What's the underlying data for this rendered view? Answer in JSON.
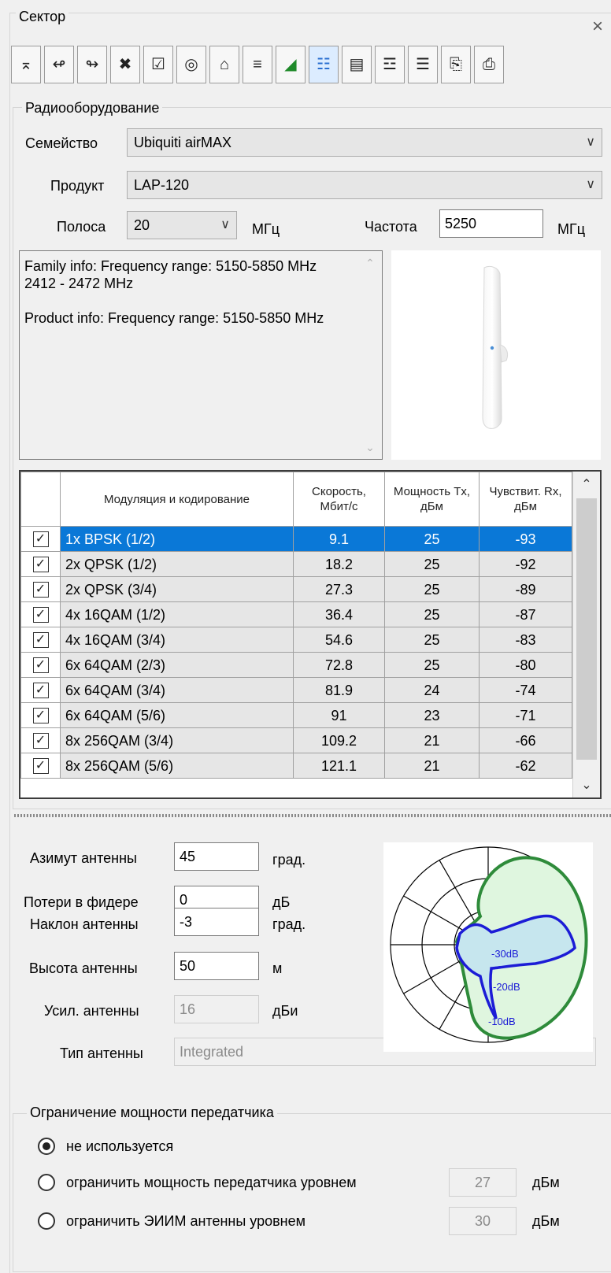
{
  "panel": {
    "title": "Сектор",
    "close_icon": "close-icon"
  },
  "toolbar": {
    "buttons": [
      {
        "icon": "add-sector-icon",
        "glyph": "⌅"
      },
      {
        "icon": "rotate-left-icon",
        "glyph": "↫"
      },
      {
        "icon": "rotate-right-icon",
        "glyph": "↬"
      },
      {
        "icon": "delete-icon",
        "glyph": "✖"
      },
      {
        "icon": "checkbox-icon",
        "glyph": "☑"
      },
      {
        "icon": "target-icon",
        "glyph": "◎"
      },
      {
        "icon": "add-link-icon",
        "glyph": "⌂"
      },
      {
        "icon": "sort-icon",
        "glyph": "≡"
      },
      {
        "icon": "terrain-chart-icon",
        "glyph": "◢"
      },
      {
        "icon": "document-icon",
        "glyph": "☷"
      },
      {
        "icon": "card-icon",
        "glyph": "▤"
      },
      {
        "icon": "settings-sliders-icon",
        "glyph": "☲"
      },
      {
        "icon": "list-settings-icon",
        "glyph": "☰"
      },
      {
        "icon": "copy-icon",
        "glyph": "⎘"
      },
      {
        "icon": "paste-icon",
        "glyph": "⎙"
      }
    ]
  },
  "radio_group": {
    "title": "Радиооборудование",
    "family_label": "Семейство",
    "family_value": "Ubiquiti airMAX",
    "product_label": "Продукт",
    "product_value": "LAP-120",
    "band_label": "Полоса",
    "band_value": "20",
    "band_unit": "МГц",
    "freq_label": "Частота",
    "freq_value": "5250",
    "freq_unit": "МГц",
    "info_text": "Family info: Frequency range: 5150-5850 MHz\n2412 - 2472 MHz\n\nProduct info: Frequency range: 5150-5850 MHz"
  },
  "modulation_table": {
    "headers": {
      "modulation": "Модуляция и кодирование",
      "speed": "Скорость, Мбит/с",
      "power": "Мощность Tx, дБм",
      "sensitivity": "Чувствит. Rx, дБм"
    },
    "rows": [
      {
        "checked": true,
        "selected": true,
        "modulation": "1x BPSK (1/2)",
        "speed": "9.1",
        "power": "25",
        "sensitivity": "-93"
      },
      {
        "checked": true,
        "selected": false,
        "modulation": "2x QPSK (1/2)",
        "speed": "18.2",
        "power": "25",
        "sensitivity": "-92"
      },
      {
        "checked": true,
        "selected": false,
        "modulation": "2x QPSK (3/4)",
        "speed": "27.3",
        "power": "25",
        "sensitivity": "-89"
      },
      {
        "checked": true,
        "selected": false,
        "modulation": "4x 16QAM (1/2)",
        "speed": "36.4",
        "power": "25",
        "sensitivity": "-87"
      },
      {
        "checked": true,
        "selected": false,
        "modulation": "4x 16QAM (3/4)",
        "speed": "54.6",
        "power": "25",
        "sensitivity": "-83"
      },
      {
        "checked": true,
        "selected": false,
        "modulation": "6x 64QAM (2/3)",
        "speed": "72.8",
        "power": "25",
        "sensitivity": "-80"
      },
      {
        "checked": true,
        "selected": false,
        "modulation": "6x 64QAM (3/4)",
        "speed": "81.9",
        "power": "24",
        "sensitivity": "-74"
      },
      {
        "checked": true,
        "selected": false,
        "modulation": "6x 64QAM (5/6)",
        "speed": "91",
        "power": "23",
        "sensitivity": "-71"
      },
      {
        "checked": true,
        "selected": false,
        "modulation": "8x 256QAM (3/4)",
        "speed": "109.2",
        "power": "21",
        "sensitivity": "-66"
      },
      {
        "checked": true,
        "selected": false,
        "modulation": "8x 256QAM (5/6)",
        "speed": "121.1",
        "power": "21",
        "sensitivity": "-62"
      }
    ]
  },
  "antenna": {
    "azimuth_label": "Азимут антенны",
    "azimuth_value": "45",
    "azimuth_unit": "град.",
    "feeder_label": "Потери в фидере",
    "feeder_value": "0",
    "feeder_unit": "дБ",
    "tilt_label": "Наклон антенны",
    "tilt_value": "-3",
    "tilt_unit": "град.",
    "height_label": "Высота антенны",
    "height_value": "50",
    "height_unit": "м",
    "gain_label": "Усил. антенны",
    "gain_value": "16",
    "gain_unit": "дБи",
    "type_label": "Тип антенны",
    "type_value": "Integrated",
    "pattern_labels": [
      "-30dB",
      "-20dB",
      "-10dB"
    ],
    "pattern_colors": {
      "horizontal": "#2e8b3a",
      "vertical": "#1c1cd6"
    }
  },
  "power_limit": {
    "title": "Ограничение мощности передатчика",
    "options": [
      {
        "label": "не используется",
        "checked": true
      },
      {
        "label": "ограничить мощность передатчика уровнем",
        "checked": false,
        "value": "27",
        "unit": "дБм"
      },
      {
        "label": "ограничить ЭИИМ антенны уровнем",
        "checked": false,
        "value": "30",
        "unit": "дБм"
      }
    ]
  }
}
